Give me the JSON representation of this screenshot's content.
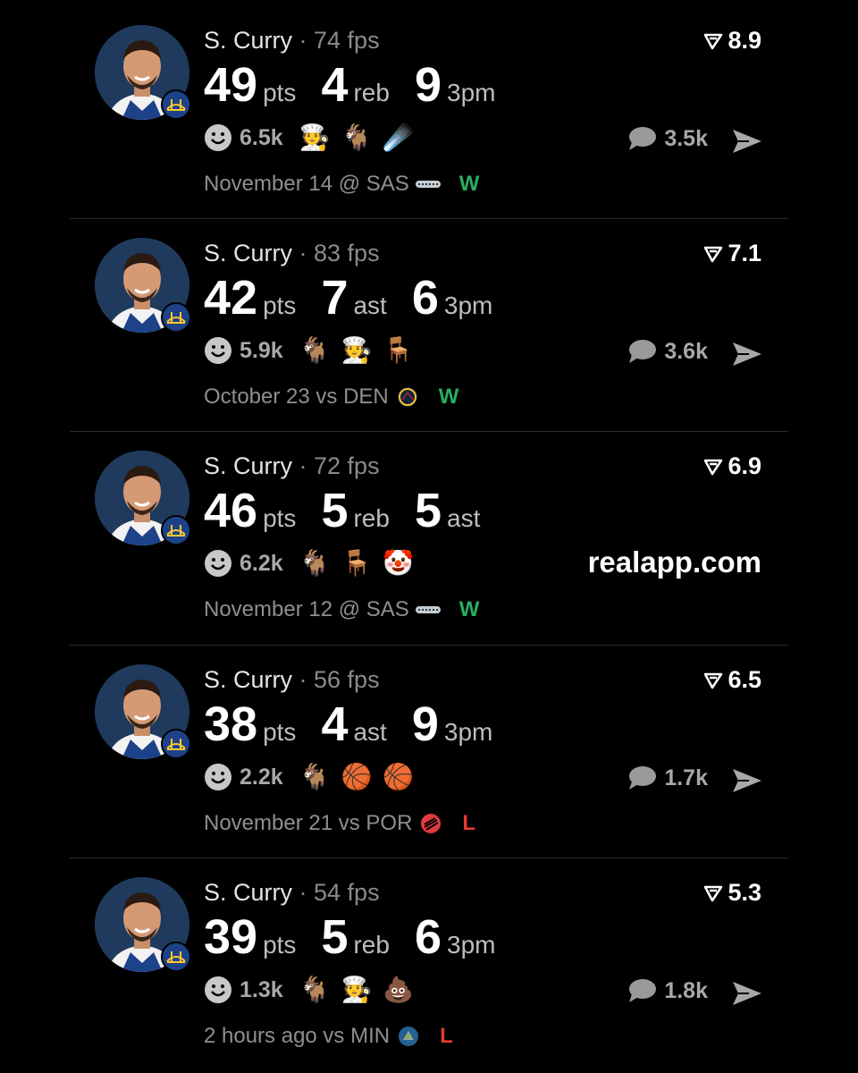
{
  "colors": {
    "background": "#000000",
    "win": "#27ae60",
    "loss": "#e53935",
    "muted": "#8f8f8f"
  },
  "posts": [
    {
      "name": "S. Curry",
      "fps": "· 74 fps",
      "rank": "8.9",
      "stats": [
        {
          "value": "49",
          "unit": "pts"
        },
        {
          "value": "4",
          "unit": "reb"
        },
        {
          "value": "9",
          "unit": "3pm"
        }
      ],
      "reaction_count": "6.5k",
      "emojis": [
        "🧑‍🍳",
        "🐐",
        "☄️"
      ],
      "comment_count": "3.5k",
      "show_share": true,
      "watermark": "",
      "date": "November 14 @ SAS",
      "opponent_logo": "spurs-logo",
      "result": "W"
    },
    {
      "name": "S. Curry",
      "fps": "· 83 fps",
      "rank": "7.1",
      "stats": [
        {
          "value": "42",
          "unit": "pts"
        },
        {
          "value": "7",
          "unit": "ast"
        },
        {
          "value": "6",
          "unit": "3pm"
        }
      ],
      "reaction_count": "5.9k",
      "emojis": [
        "🐐",
        "🧑‍🍳",
        "🪑"
      ],
      "comment_count": "3.6k",
      "show_share": true,
      "watermark": "",
      "date": "October 23 vs DEN",
      "opponent_logo": "nuggets-logo",
      "result": "W"
    },
    {
      "name": "S. Curry",
      "fps": "· 72 fps",
      "rank": "6.9",
      "stats": [
        {
          "value": "46",
          "unit": "pts"
        },
        {
          "value": "5",
          "unit": "reb"
        },
        {
          "value": "5",
          "unit": "ast"
        }
      ],
      "reaction_count": "6.2k",
      "emojis": [
        "🐐",
        "🪑",
        "🤡"
      ],
      "comment_count": "",
      "show_share": false,
      "watermark": "realapp.com",
      "date": "November 12 @ SAS",
      "opponent_logo": "spurs-logo",
      "result": "W"
    },
    {
      "name": "S. Curry",
      "fps": "· 56 fps",
      "rank": "6.5",
      "stats": [
        {
          "value": "38",
          "unit": "pts"
        },
        {
          "value": "4",
          "unit": "ast"
        },
        {
          "value": "9",
          "unit": "3pm"
        }
      ],
      "reaction_count": "2.2k",
      "emojis": [
        "🐐",
        "🏀",
        "🏀"
      ],
      "comment_count": "1.7k",
      "show_share": true,
      "watermark": "",
      "date": "November 21 vs POR",
      "opponent_logo": "blazers-logo",
      "result": "L"
    },
    {
      "name": "S. Curry",
      "fps": "· 54 fps",
      "rank": "5.3",
      "stats": [
        {
          "value": "39",
          "unit": "pts"
        },
        {
          "value": "5",
          "unit": "reb"
        },
        {
          "value": "6",
          "unit": "3pm"
        }
      ],
      "reaction_count": "1.3k",
      "emojis": [
        "🐐",
        "🧑‍🍳",
        "💩"
      ],
      "comment_count": "1.8k",
      "show_share": true,
      "watermark": "",
      "date": "2 hours ago vs MIN",
      "opponent_logo": "timberwolves-logo",
      "result": "L"
    }
  ]
}
